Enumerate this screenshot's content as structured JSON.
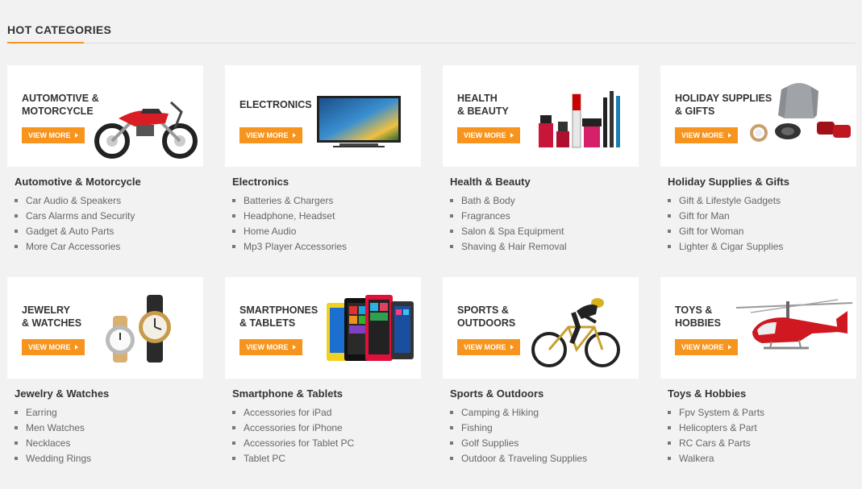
{
  "section": {
    "title": "HOT CATEGORIES"
  },
  "colors": {
    "accent": "#f7941d"
  },
  "categories": [
    {
      "banner_line1": "AUTOMOTIVE &",
      "banner_line2": "MOTORCYCLE",
      "view_more": "VIEW MORE",
      "image_icon": "motorcycle-image",
      "title": "Automotive & Motorcycle",
      "links": [
        "Car Audio & Speakers",
        "Cars Alarms and Security",
        "Gadget & Auto Parts",
        "More Car Accessories"
      ]
    },
    {
      "banner_line1": "ELECTRONICS",
      "banner_line2": "",
      "view_more": "VIEW MORE",
      "image_icon": "tv-image",
      "title": "Electronics",
      "links": [
        "Batteries & Chargers",
        "Headphone, Headset",
        "Home Audio",
        "Mp3 Player Accessories"
      ]
    },
    {
      "banner_line1": "HEALTH",
      "banner_line2": "& BEAUTY",
      "view_more": "VIEW MORE",
      "image_icon": "cosmetics-image",
      "title": "Health & Beauty",
      "links": [
        "Bath & Body",
        "Fragrances",
        "Salon & Spa Equipment",
        "Shaving & Hair Removal"
      ]
    },
    {
      "banner_line1": "HOLIDAY SUPPLIES",
      "banner_line2": "& GIFTS",
      "view_more": "VIEW MORE",
      "image_icon": "gifts-image",
      "title": "Holiday Supplies & Gifts",
      "links": [
        "Gift & Lifestyle Gadgets",
        "Gift for Man",
        "Gift for Woman",
        "Lighter & Cigar Supplies"
      ]
    },
    {
      "banner_line1": "JEWELRY",
      "banner_line2": "& WATCHES",
      "view_more": "VIEW MORE",
      "image_icon": "watches-image",
      "title": "Jewelry & Watches",
      "links": [
        "Earring",
        "Men Watches",
        "Necklaces",
        "Wedding Rings"
      ]
    },
    {
      "banner_line1": "SMARTPHONES",
      "banner_line2": "& TABLETS",
      "view_more": "VIEW MORE",
      "image_icon": "smartphones-image",
      "title": "Smartphone & Tablets",
      "links": [
        "Accessories for iPad",
        "Accessories for iPhone",
        "Accessories for Tablet PC",
        "Tablet PC"
      ]
    },
    {
      "banner_line1": "SPORTS &",
      "banner_line2": "OUTDOORS",
      "view_more": "VIEW MORE",
      "image_icon": "cyclist-image",
      "title": "Sports & Outdoors",
      "links": [
        "Camping & Hiking",
        "Fishing",
        "Golf Supplies",
        "Outdoor & Traveling Supplies"
      ]
    },
    {
      "banner_line1": "TOYS &",
      "banner_line2": "HOBBIES",
      "view_more": "VIEW MORE",
      "image_icon": "helicopter-image",
      "title": "Toys & Hobbies",
      "links": [
        "Fpv System & Parts",
        "Helicopters & Part",
        "RC Cars & Parts",
        "Walkera"
      ]
    }
  ]
}
